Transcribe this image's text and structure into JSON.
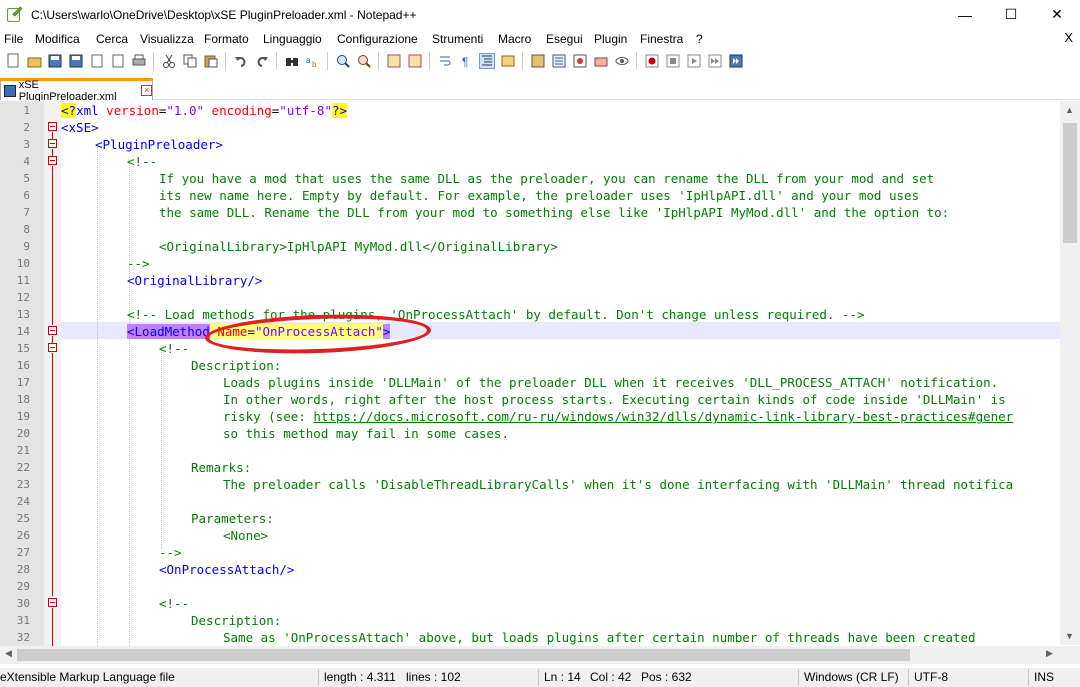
{
  "window": {
    "title": "C:\\Users\\warlo\\OneDrive\\Desktop\\xSE PluginPreloader.xml - Notepad++",
    "minimize": "—",
    "maximize": "☐",
    "close": "✕"
  },
  "menu": {
    "items": [
      "File",
      "Modifica",
      "Cerca",
      "Visualizza",
      "Formato",
      "Linguaggio",
      "Configurazione",
      "Strumenti",
      "Macro",
      "Esegui",
      "Plugin",
      "Finestra",
      "?"
    ],
    "close_doc": "X"
  },
  "tab": {
    "label": "xSE PluginPreloader.xml",
    "close": "×"
  },
  "editor": {
    "line_numbers": [
      "1",
      "2",
      "3",
      "4",
      "5",
      "6",
      "7",
      "8",
      "9",
      "10",
      "11",
      "12",
      "13",
      "14",
      "15",
      "16",
      "17",
      "18",
      "19",
      "20",
      "21",
      "22",
      "23",
      "24",
      "25",
      "26",
      "27",
      "28",
      "29",
      "30",
      "31",
      "32"
    ],
    "l1_a": "<?",
    "l1_b": "xml ",
    "l1_c": "version",
    "l1_d": "=",
    "l1_e": "\"1.0\"",
    "l1_f": " encoding",
    "l1_g": "=",
    "l1_h": "\"utf-8\"",
    "l1_i": "?>",
    "l2": "<xSE>",
    "l3": "<PluginPreloader>",
    "l4": "<!--",
    "l5": "If you have a mod that uses the same DLL as the preloader, you can rename the DLL from your mod and set",
    "l6": "its new name here. Empty by default. For example, the preloader uses 'IpHlpAPI.dll' and your mod uses",
    "l7": "the same DLL. Rename the DLL from your mod to something else like 'IpHlpAPI MyMod.dll' and the option to:",
    "l9": "<OriginalLibrary>IpHlpAPI MyMod.dll</OriginalLibrary>",
    "l10": "-->",
    "l11": "<OriginalLibrary/>",
    "l13": "<!-- Load methods for the plugins, 'OnProcessAttach' by default. Don't change unless required. -->",
    "l14_a": "<",
    "l14_b": "LoadMethod",
    "l14_c": " Name",
    "l14_d": "=",
    "l14_e": "\"OnProcessAttach\"",
    "l14_f": ">",
    "l15": "<!--",
    "l16": "Description:",
    "l17": "Loads plugins inside 'DLLMain' of the preloader DLL when it receives 'DLL_PROCESS_ATTACH' notification.",
    "l18": "In other words, right after the host process starts. Executing certain kinds of code inside 'DLLMain' is",
    "l19_a": "risky (see: ",
    "l19_b": "https://docs.microsoft.com/ru-ru/windows/win32/dlls/dynamic-link-library-best-practices#gener",
    "l20": "so this method may fail in some cases.",
    "l22": "Remarks:",
    "l23": "The preloader calls 'DisableThreadLibraryCalls' when it's done interfacing with 'DLLMain' thread notifica",
    "l25": "Parameters:",
    "l26": "<None>",
    "l27": "-->",
    "l28": "<OnProcessAttach/>",
    "l30": "<!--",
    "l31": "Description:",
    "l32": "Same as 'OnProcessAttach' above, but loads plugins after certain number of threads have been created"
  },
  "status": {
    "filetype": "eXtensible Markup Language file",
    "length": "length : 4.311",
    "lines": "lines : 102",
    "ln": "Ln : 14",
    "col": "Col : 42",
    "pos": "Pos : 632",
    "eol": "Windows (CR LF)",
    "encoding": "UTF-8",
    "mode": "INS"
  },
  "colors": {
    "tag": "#0000ff",
    "attribute": "#ff0000",
    "value": "#8000ff",
    "comment": "#008000",
    "highlight": "#ffff00",
    "annotation": "#e02020"
  },
  "icons": [
    "new-file-icon",
    "open-file-icon",
    "save-icon",
    "save-all-icon",
    "close-icon",
    "close-all-icon",
    "print-icon",
    "cut-icon",
    "copy-icon",
    "paste-icon",
    "undo-icon",
    "redo-icon",
    "find-icon",
    "replace-icon",
    "zoom-in-icon",
    "zoom-out-icon",
    "sync-v-icon",
    "sync-h-icon",
    "word-wrap-icon",
    "show-all-icon",
    "indent-guide-icon",
    "udl-icon",
    "doc-map-icon",
    "function-list-icon",
    "folder-workspace-icon",
    "monitor-icon",
    "record-icon",
    "stop-icon",
    "play-icon",
    "play-multiple-icon",
    "save-macro-icon"
  ]
}
